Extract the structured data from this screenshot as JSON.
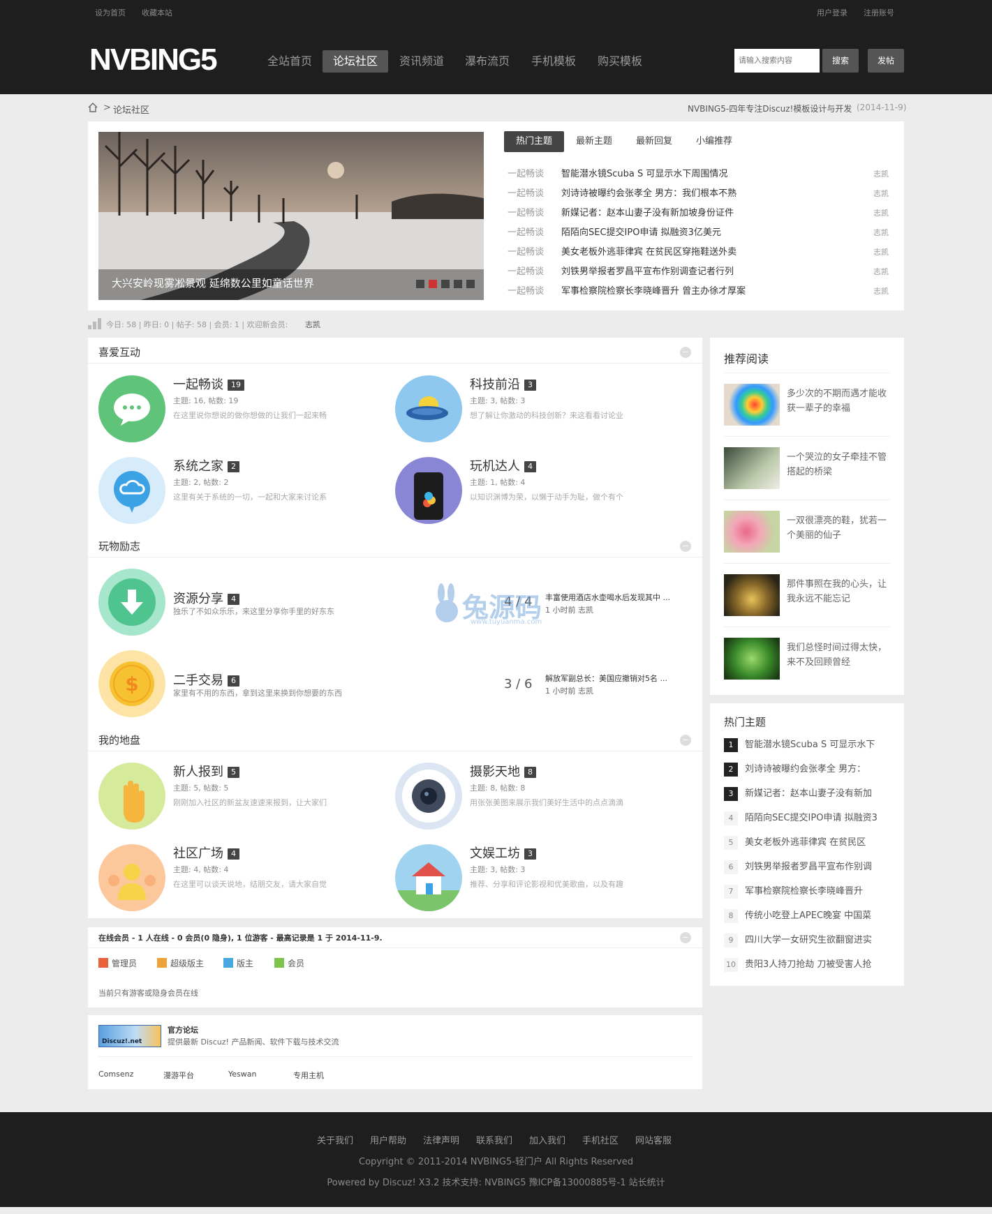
{
  "top": {
    "left_links": [
      "设为首页",
      "收藏本站"
    ],
    "right_links": [
      "用户登录",
      "注册账号"
    ]
  },
  "logo": "NVBING5",
  "nav": [
    "全站首页",
    "论坛社区",
    "资讯频道",
    "瀑布流页",
    "手机模板",
    "购买模板"
  ],
  "search": {
    "placeholder": "请输入搜索内容",
    "button": "搜索",
    "post_button": "发帖"
  },
  "breadcrumb": {
    "current": "论坛社区",
    "separator": ">",
    "slogan": "NVBING5-四年专注Discuz!模板设计与开发",
    "date": "(2014-11-9)"
  },
  "slider": {
    "caption": "大兴安岭现雾凇景观 延绵数公里如童话世界",
    "dots": 5,
    "active_dot": 2
  },
  "tabs": [
    "热门主题",
    "最新主题",
    "最新回复",
    "小编推荐"
  ],
  "threads": [
    {
      "cat": "一起畅谈",
      "title": "智能潜水镜Scuba S 可显示水下周围情况",
      "author": "志凯"
    },
    {
      "cat": "一起畅谈",
      "title": "刘诗诗被曝约会张孝全 男方：我们根本不熟",
      "author": "志凯"
    },
    {
      "cat": "一起畅谈",
      "title": "新媒记者：赵本山妻子没有新加坡身份证件",
      "author": "志凯"
    },
    {
      "cat": "一起畅谈",
      "title": "陌陌向SEC提交IPO申请 拟融资3亿美元",
      "author": "志凯"
    },
    {
      "cat": "一起畅谈",
      "title": "美女老板外逃菲律宾 在贫民区穿拖鞋送外卖",
      "author": "志凯"
    },
    {
      "cat": "一起畅谈",
      "title": "刘铁男举报者罗昌平宣布作别调查记者行列",
      "author": "志凯"
    },
    {
      "cat": "一起畅谈",
      "title": "军事检察院检察长李晓峰晋升 曾主办徐才厚案",
      "author": "志凯"
    }
  ],
  "stats": {
    "text": "今日: 58 | 昨日: 0 | 帖子: 58 | 会员: 1 | 欢迎新会员:",
    "newest": "志凯"
  },
  "groups": [
    {
      "title": "喜爱互动",
      "forums": [
        {
          "name": "一起畅谈",
          "count": "19",
          "stat": "主题: 16, 帖数: 19",
          "desc": "在这里说你想说的做你想做的让我们一起来畅"
        },
        {
          "name": "科技前沿",
          "count": "3",
          "stat": "主题: 3, 帖数: 3",
          "desc": "想了解让你激动的科技创新？来这看看讨论业"
        },
        {
          "name": "系统之家",
          "count": "2",
          "stat": "主题: 2, 帖数: 2",
          "desc": "这里有关于系统的一切，一起和大家来讨论系"
        },
        {
          "name": "玩机达人",
          "count": "4",
          "stat": "主题: 1, 帖数: 4",
          "desc": "以知识渊博为荣，以懒于动手为耻，做个有个"
        }
      ]
    },
    {
      "title": "玩物励志",
      "forums": [
        {
          "name": "资源分享",
          "count": "4",
          "desc": "独乐了不如众乐乐，来这里分享你手里的好东东",
          "num": "4 / 4",
          "last_title": "丰富使用酒店水壶喝水后发现其中 ...",
          "last_meta": "1 小时前 志凯"
        },
        {
          "name": "二手交易",
          "count": "6",
          "desc": "家里有不用的东西，拿到这里来换到你想要的东西",
          "num": "3 / 6",
          "last_title": "解放军副总长：美国应撤销对5名 ...",
          "last_meta": "1 小时前 志凯"
        }
      ]
    },
    {
      "title": "我的地盘",
      "forums": [
        {
          "name": "新人报到",
          "count": "5",
          "stat": "主题: 5, 帖数: 5",
          "desc": "刚刚加入社区的新盆友速速来报到，让大家们"
        },
        {
          "name": "摄影天地",
          "count": "8",
          "stat": "主题: 8, 帖数: 8",
          "desc": "用张张美图来展示我们美好生活中的点点滴滴"
        },
        {
          "name": "社区广场",
          "count": "4",
          "stat": "主题: 4, 帖数: 4",
          "desc": "在这里可以谈天说地，结朋交友，请大家自觉"
        },
        {
          "name": "文娱工坊",
          "count": "3",
          "stat": "主题: 3, 帖数: 3",
          "desc": "推荐、分享和评论影视和优美歌曲，以及有趣"
        }
      ]
    }
  ],
  "online": {
    "title": "在线会员 - 1 人在线 - 0 会员(0 隐身), 1 位游客 - 最高记录是 1 于 2014-11-9.",
    "legend": [
      "管理员",
      "超级版主",
      "版主",
      "会员"
    ],
    "note": "当前只有游客或隐身会员在线"
  },
  "links": {
    "logo_text": "Discuz!.net",
    "title": "官方论坛",
    "desc": "提供最新 Discuz! 产品新闻、软件下载与技术交流",
    "items": [
      "Comsenz",
      "漫游平台",
      "Yeswan",
      "专用主机"
    ]
  },
  "recommend": {
    "title": "推荐阅读",
    "items": [
      "多少次的不期而遇才能收获一辈子的幸福",
      "一个哭泣的女子牵挂不管搭起的桥梁",
      "一双很漂亮的鞋，犹若一个美丽的仙子",
      "那件事照在我的心头，让我永远不能忘记",
      "我们总怪时间过得太快，来不及回顾曾经"
    ]
  },
  "hot": {
    "title": "热门主题",
    "items": [
      "智能潜水镜Scuba S 可显示水下",
      "刘诗诗被曝约会张孝全 男方：",
      "新媒记者：赵本山妻子没有新加",
      "陌陌向SEC提交IPO申请 拟融资3",
      "美女老板外逃菲律宾 在贫民区",
      "刘铁男举报者罗昌平宣布作别调",
      "军事检察院检察长李晓峰晋升",
      "传统小吃登上APEC晚宴 中国菜",
      "四川大学一女研究生欲翻窗进实",
      "贵阳3人持刀抢劫 刀被受害人抢"
    ]
  },
  "watermark": {
    "main": "兔源码",
    "sub": "www.tuyuanma.com"
  },
  "footer": {
    "links": [
      "关于我们",
      "用户帮助",
      "法律声明",
      "联系我们",
      "加入我们",
      "手机社区",
      "网站客服"
    ],
    "copyright": "Copyright © 2011-2014 NVBING5-轻门户 All Rights Reserved",
    "powered": "Powered by Discuz! X3.2 技术支持: NVBING5 豫ICP备13000885号-1 站长统计"
  }
}
